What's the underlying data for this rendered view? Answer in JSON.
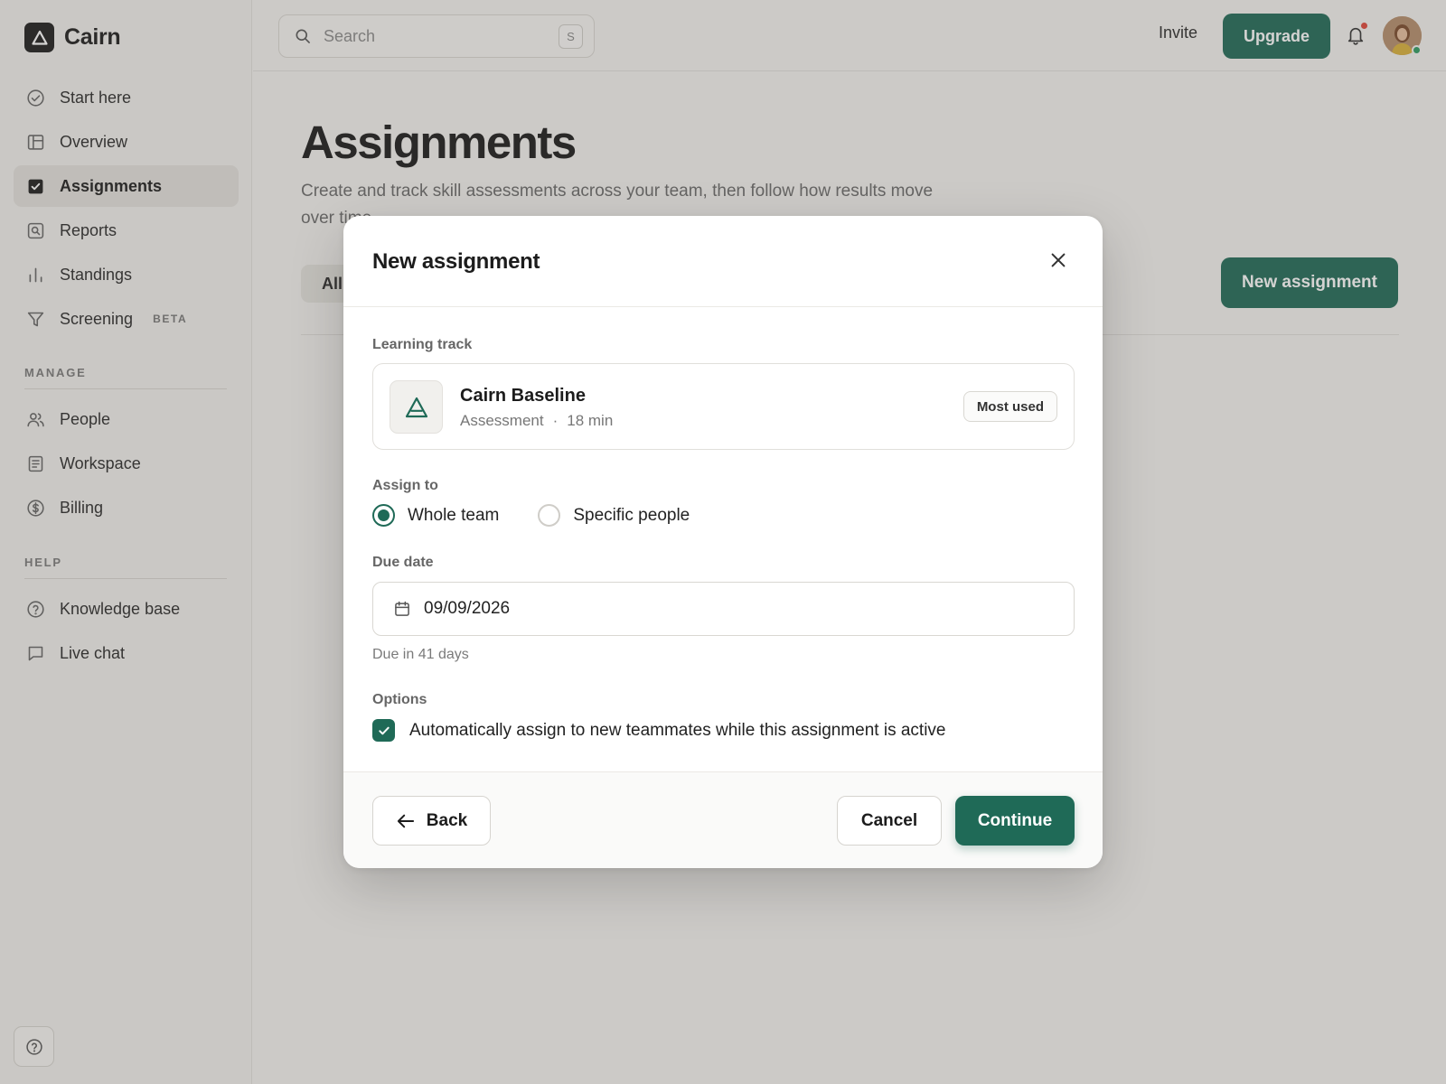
{
  "app": {
    "name": "Cairn"
  },
  "sidebar": {
    "primary": [
      {
        "label": "Start here",
        "icon": "check-circle-icon"
      },
      {
        "label": "Overview",
        "icon": "layout-icon"
      },
      {
        "label": "Assignments",
        "icon": "checkbox-icon",
        "active": true
      },
      {
        "label": "Reports",
        "icon": "report-search-icon"
      },
      {
        "label": "Standings",
        "icon": "bar-chart-icon"
      },
      {
        "label": "Screening",
        "icon": "filter-icon",
        "badge": "BETA"
      }
    ],
    "manage_label": "MANAGE",
    "manage": [
      {
        "label": "People",
        "icon": "people-icon"
      },
      {
        "label": "Workspace",
        "icon": "document-icon"
      },
      {
        "label": "Billing",
        "icon": "dollar-circle-icon"
      }
    ],
    "help_label": "HELP",
    "help": [
      {
        "label": "Knowledge base",
        "icon": "help-circle-icon"
      },
      {
        "label": "Live chat",
        "icon": "chat-icon"
      }
    ]
  },
  "topbar": {
    "search_placeholder": "Search",
    "search_shortcut": "S",
    "invite_label": "Invite",
    "upgrade_label": "Upgrade"
  },
  "page": {
    "title": "Assignments",
    "description": "Create and track skill assessments across your team, then follow how results move over time.",
    "tab_all": "All",
    "new_assignment_label": "New assignment"
  },
  "modal": {
    "title": "New assignment",
    "learning_track_label": "Learning track",
    "track": {
      "name": "Cairn Baseline",
      "type": "Assessment",
      "separator": "·",
      "duration": "18 min",
      "badge": "Most used"
    },
    "assign_to_label": "Assign to",
    "assign_options": [
      {
        "label": "Whole team",
        "selected": true
      },
      {
        "label": "Specific people",
        "selected": false
      }
    ],
    "due_date_label": "Due date",
    "due_date_value": "09/09/2026",
    "due_hint": "Due in 41 days",
    "options_label": "Options",
    "auto_assign_label": "Automatically assign to new teammates while this assignment is active",
    "auto_assign_checked": true,
    "back_label": "Back",
    "cancel_label": "Cancel",
    "continue_label": "Continue"
  },
  "colors": {
    "accent": "#1f6a57",
    "notification": "#e0473a",
    "online": "#2e9b62"
  }
}
